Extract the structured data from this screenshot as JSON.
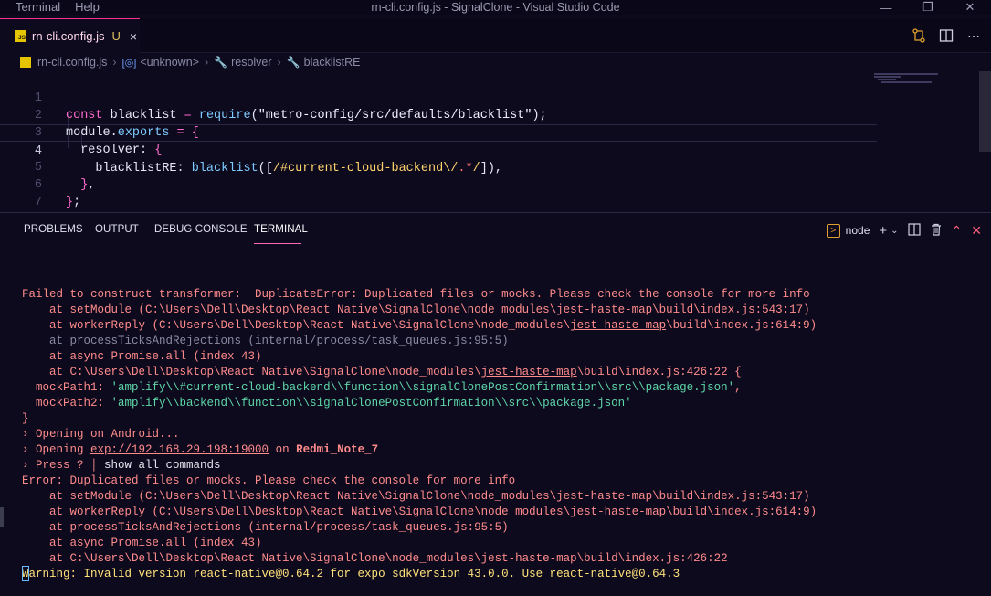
{
  "menu": [
    "Terminal",
    "Help"
  ],
  "window_title": "rn-cli.config.js - SignalClone - Visual Studio Code",
  "tab": {
    "badge": "JS",
    "name": "rn-cli.config.js",
    "status": "U",
    "close": "×"
  },
  "breadcrumb": {
    "file": "rn-cli.config.js",
    "item1": "<unknown>",
    "item2": "resolver",
    "item3": "blacklistRE"
  },
  "code_lines": [
    "1",
    "2",
    "3",
    "4",
    "5",
    "6",
    "7"
  ],
  "panel": {
    "tabs": [
      "PROBLEMS",
      "OUTPUT",
      "DEBUG CONSOLE",
      "TERMINAL"
    ],
    "active_tab": "TERMINAL",
    "shell": "node"
  },
  "terminal": {
    "l1": "Failed to construct transformer:  DuplicateError: Duplicated files or mocks. Please check the console for more info",
    "l2a": "    at setModule (C:\\Users\\Dell\\Desktop\\React Native\\SignalClone\\node_modules\\",
    "l2b": "jest-haste-map",
    "l2c": "\\build\\index.js:543:17)",
    "l3a": "    at workerReply (C:\\Users\\Dell\\Desktop\\React Native\\SignalClone\\node_modules\\",
    "l3b": "jest-haste-map",
    "l3c": "\\build\\index.js:614:9)",
    "l4": "    at processTicksAndRejections (internal/process/task_queues.js:95:5)",
    "l5": "    at async Promise.all (index 43)",
    "l6a": "    at C:\\Users\\Dell\\Desktop\\React Native\\SignalClone\\node_modules\\",
    "l6b": "jest-haste-map",
    "l6c": "\\build\\index.js:426:22 {",
    "l7a": "  mockPath1: ",
    "l7b": "'amplify\\\\#current-cloud-backend\\\\function\\\\signalClonePostConfirmation\\\\src\\\\package.json'",
    "l7c": ",",
    "l8a": "  mockPath2: ",
    "l8b": "'amplify\\\\backend\\\\function\\\\signalClonePostConfirmation\\\\src\\\\package.json'",
    "l9": "}",
    "l10": "› Opening on Android...",
    "l11a": "› Opening ",
    "l11b": "exp://192.168.29.198:19000",
    "l11c": " on ",
    "l11d": "Redmi_Note_7",
    "l12a": "› Press ? │ ",
    "l12b": "show all commands",
    "l13": "Error: Duplicated files or mocks. Please check the console for more info",
    "l14": "    at setModule (C:\\Users\\Dell\\Desktop\\React Native\\SignalClone\\node_modules\\jest-haste-map\\build\\index.js:543:17)",
    "l15": "    at workerReply (C:\\Users\\Dell\\Desktop\\React Native\\SignalClone\\node_modules\\jest-haste-map\\build\\index.js:614:9)",
    "l16": "    at processTicksAndRejections (internal/process/task_queues.js:95:5)",
    "l17": "    at async Promise.all (index 43)",
    "l18": "    at C:\\Users\\Dell\\Desktop\\React Native\\SignalClone\\node_modules\\jest-haste-map\\build\\index.js:426:22",
    "l19": "Warning: Invalid version react-native@0.64.2 for expo sdkVersion 43.0.0. Use react-native@0.64.3"
  },
  "colors": {
    "accent": "#ff2f92",
    "background": "#0d0a1e",
    "terminal_error": "#ff8b8b",
    "terminal_warning": "#ffe27a"
  }
}
